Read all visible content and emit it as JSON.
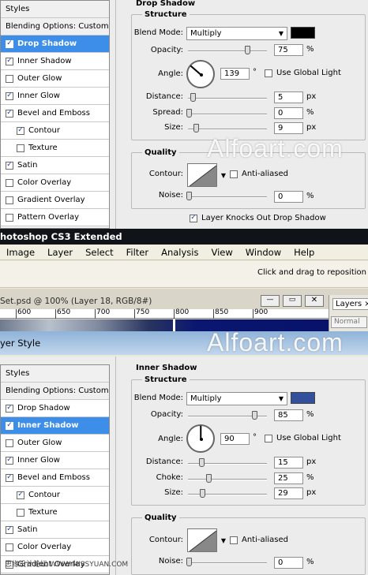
{
  "top_left": {
    "header": "Styles",
    "blend_options": "Blending Options: Custom",
    "items": [
      {
        "label": "Drop Shadow",
        "checked": true,
        "selected": true
      },
      {
        "label": "Inner Shadow",
        "checked": true
      },
      {
        "label": "Outer Glow",
        "checked": false
      },
      {
        "label": "Inner Glow",
        "checked": true
      },
      {
        "label": "Bevel and Emboss",
        "checked": true
      },
      {
        "label": "Contour",
        "checked": true,
        "indent": true
      },
      {
        "label": "Texture",
        "checked": false,
        "indent": true
      },
      {
        "label": "Satin",
        "checked": true
      },
      {
        "label": "Color Overlay",
        "checked": false
      },
      {
        "label": "Gradient Overlay",
        "checked": false
      },
      {
        "label": "Pattern Overlay",
        "checked": false
      }
    ]
  },
  "top_panel": {
    "title": "Drop Shadow",
    "structure_title": "Structure",
    "blend_mode_label": "Blend Mode:",
    "blend_mode": "Multiply",
    "color": "#000000",
    "opacity_label": "Opacity:",
    "opacity": "75",
    "angle_label": "Angle:",
    "angle": "139",
    "degree": "°",
    "global_light": "Use Global Light",
    "distance_label": "Distance:",
    "distance": "5",
    "spread_label": "Spread:",
    "spread": "0",
    "size_label": "Size:",
    "size": "9",
    "quality_title": "Quality",
    "contour_label": "Contour:",
    "anti_aliased": "Anti-aliased",
    "noise_label": "Noise:",
    "noise": "0",
    "knockout": "Layer Knocks Out Drop Shadow",
    "px": "px",
    "pct": "%"
  },
  "watermark": "Alfoart.com",
  "app": {
    "title": "hotoshop CS3 Extended",
    "menu": [
      "Image",
      "Layer",
      "Select",
      "Filter",
      "Analysis",
      "View",
      "Window",
      "Help"
    ],
    "hint": "Click and drag to reposition the",
    "doc_tab": "Set.psd @ 100% (Layer 18, RGB/8#)",
    "ruler": [
      "600",
      "650",
      "700",
      "750",
      "800",
      "850",
      "900"
    ],
    "layers_tab": "Layers",
    "layers_close": "×",
    "blend_normal": "Normal",
    "layer_style_title": "yer Style"
  },
  "bottom_left": {
    "header": "Styles",
    "blend_options": "Blending Options: Custom",
    "items": [
      {
        "label": "Drop Shadow",
        "checked": true
      },
      {
        "label": "Inner Shadow",
        "checked": true,
        "selected": true
      },
      {
        "label": "Outer Glow",
        "checked": false
      },
      {
        "label": "Inner Glow",
        "checked": true
      },
      {
        "label": "Bevel and Emboss",
        "checked": true
      },
      {
        "label": "Contour",
        "checked": true,
        "indent": true
      },
      {
        "label": "Texture",
        "checked": false,
        "indent": true
      },
      {
        "label": "Satin",
        "checked": true
      },
      {
        "label": "Color Overlay",
        "checked": false
      },
      {
        "label": "Gradient Overlay",
        "checked": false
      }
    ]
  },
  "bottom_panel": {
    "title": "Inner Shadow",
    "structure_title": "Structure",
    "blend_mode_label": "Blend Mode:",
    "blend_mode": "Multiply",
    "color": "#33509c",
    "opacity_label": "Opacity:",
    "opacity": "85",
    "angle_label": "Angle:",
    "angle": "90",
    "degree": "°",
    "global_light": "Use Global Light",
    "distance_label": "Distance:",
    "distance": "15",
    "choke_label": "Choke:",
    "choke": "25",
    "size_label": "Size:",
    "size": "29",
    "quality_title": "Quality",
    "contour_label": "Contour:",
    "anti_aliased": "Anti-aliased",
    "noise_label": "Noise:",
    "noise": "0",
    "px": "px",
    "pct": "%"
  },
  "footer_watermark": "思缘设计论坛 WWW.MISSYUAN.COM",
  "colors": {
    "selection": "#3c8ee8",
    "title_bar": "#101418",
    "canvas_navy": "#0a1670"
  }
}
